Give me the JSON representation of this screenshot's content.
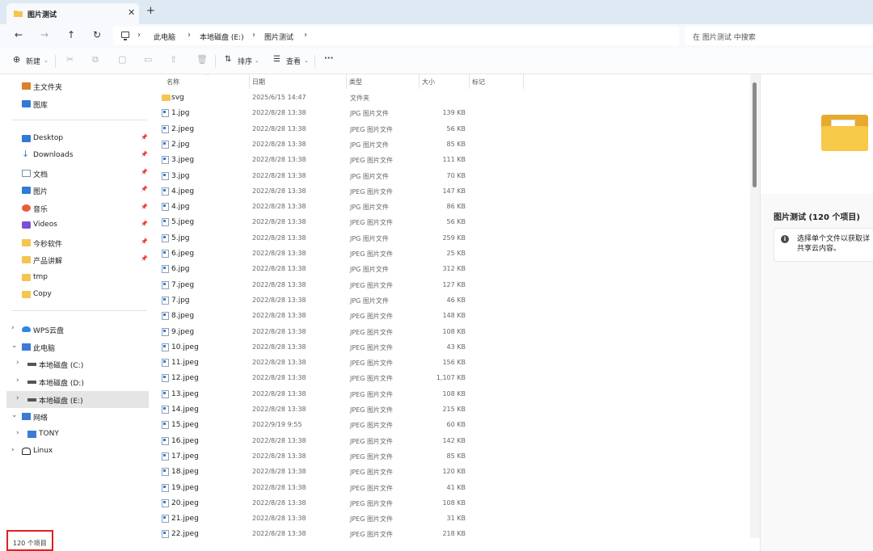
{
  "tab": {
    "title": "图片测试",
    "close": "✕",
    "new": "+"
  },
  "nav_buttons": {
    "back": "←",
    "forward": "→",
    "up": "↑",
    "refresh": "↻"
  },
  "breadcrumb": [
    "此电脑",
    "本地磁盘 (E:)",
    "图片测试"
  ],
  "search": {
    "placeholder": "在 图片测试 中搜索"
  },
  "toolbar": {
    "new_label": "新建",
    "sort_label": "排序",
    "view_label": "查看",
    "more_label": "···"
  },
  "sidebar": {
    "top": [
      {
        "label": "主文件夹",
        "icon": "home-icon"
      },
      {
        "label": "图库",
        "icon": "gallery-icon"
      }
    ],
    "quick": [
      {
        "label": "Desktop",
        "icon": "desktop-icon"
      },
      {
        "label": "Downloads",
        "icon": "download-icon"
      },
      {
        "label": "文档",
        "icon": "document-icon"
      },
      {
        "label": "图片",
        "icon": "pictures-icon"
      },
      {
        "label": "音乐",
        "icon": "music-icon"
      },
      {
        "label": "Videos",
        "icon": "videos-icon"
      },
      {
        "label": "今秒软件",
        "icon": "folder-icon"
      },
      {
        "label": "产品讲解",
        "icon": "folder-icon"
      },
      {
        "label": "tmp",
        "icon": "folder-icon"
      },
      {
        "label": "Copy",
        "icon": "folder-icon"
      }
    ],
    "tree": [
      {
        "label": "WPS云盘",
        "icon": "cloud-icon"
      },
      {
        "label": "此电脑",
        "icon": "computer-icon"
      },
      {
        "label": "本地磁盘 (C:)",
        "icon": "drive-icon"
      },
      {
        "label": "本地磁盘 (D:)",
        "icon": "drive-icon"
      },
      {
        "label": "本地磁盘 (E:)",
        "icon": "drive-icon"
      },
      {
        "label": "网络",
        "icon": "network-icon"
      },
      {
        "label": "TONY",
        "icon": "computer-icon"
      },
      {
        "label": "Linux",
        "icon": "linux-icon"
      }
    ]
  },
  "columns": {
    "name": "名称",
    "date": "日期",
    "type": "类型",
    "size": "大小",
    "tag": "标记"
  },
  "files": [
    {
      "name": "svg",
      "date": "2025/6/15 14:47",
      "type": "文件夹",
      "size": ""
    },
    {
      "name": "1.jpg",
      "date": "2022/8/28 13:38",
      "type": "JPG 图片文件",
      "size": "139 KB"
    },
    {
      "name": "2.jpeg",
      "date": "2022/8/28 13:38",
      "type": "JPEG 图片文件",
      "size": "56 KB"
    },
    {
      "name": "2.jpg",
      "date": "2022/8/28 13:38",
      "type": "JPG 图片文件",
      "size": "85 KB"
    },
    {
      "name": "3.jpeg",
      "date": "2022/8/28 13:38",
      "type": "JPEG 图片文件",
      "size": "111 KB"
    },
    {
      "name": "3.jpg",
      "date": "2022/8/28 13:38",
      "type": "JPG 图片文件",
      "size": "70 KB"
    },
    {
      "name": "4.jpeg",
      "date": "2022/8/28 13:38",
      "type": "JPEG 图片文件",
      "size": "147 KB"
    },
    {
      "name": "4.jpg",
      "date": "2022/8/28 13:38",
      "type": "JPG 图片文件",
      "size": "86 KB"
    },
    {
      "name": "5.jpeg",
      "date": "2022/8/28 13:38",
      "type": "JPEG 图片文件",
      "size": "56 KB"
    },
    {
      "name": "5.jpg",
      "date": "2022/8/28 13:38",
      "type": "JPG 图片文件",
      "size": "259 KB"
    },
    {
      "name": "6.jpeg",
      "date": "2022/8/28 13:38",
      "type": "JPEG 图片文件",
      "size": "25 KB"
    },
    {
      "name": "6.jpg",
      "date": "2022/8/28 13:38",
      "type": "JPG 图片文件",
      "size": "312 KB"
    },
    {
      "name": "7.jpeg",
      "date": "2022/8/28 13:38",
      "type": "JPEG 图片文件",
      "size": "127 KB"
    },
    {
      "name": "7.jpg",
      "date": "2022/8/28 13:38",
      "type": "JPG 图片文件",
      "size": "46 KB"
    },
    {
      "name": "8.jpeg",
      "date": "2022/8/28 13:38",
      "type": "JPEG 图片文件",
      "size": "148 KB"
    },
    {
      "name": "9.jpeg",
      "date": "2022/8/28 13:38",
      "type": "JPEG 图片文件",
      "size": "108 KB"
    },
    {
      "name": "10.jpeg",
      "date": "2022/8/28 13:38",
      "type": "JPEG 图片文件",
      "size": "43 KB"
    },
    {
      "name": "11.jpeg",
      "date": "2022/8/28 13:38",
      "type": "JPEG 图片文件",
      "size": "156 KB"
    },
    {
      "name": "12.jpeg",
      "date": "2022/8/28 13:38",
      "type": "JPEG 图片文件",
      "size": "1,107 KB"
    },
    {
      "name": "13.jpeg",
      "date": "2022/8/28 13:38",
      "type": "JPEG 图片文件",
      "size": "108 KB"
    },
    {
      "name": "14.jpeg",
      "date": "2022/8/28 13:38",
      "type": "JPEG 图片文件",
      "size": "215 KB"
    },
    {
      "name": "15.jpeg",
      "date": "2022/9/19 9:55",
      "type": "JPEG 图片文件",
      "size": "60 KB"
    },
    {
      "name": "16.jpeg",
      "date": "2022/8/28 13:38",
      "type": "JPEG 图片文件",
      "size": "142 KB"
    },
    {
      "name": "17.jpeg",
      "date": "2022/8/28 13:38",
      "type": "JPEG 图片文件",
      "size": "85 KB"
    },
    {
      "name": "18.jpeg",
      "date": "2022/8/28 13:38",
      "type": "JPEG 图片文件",
      "size": "120 KB"
    },
    {
      "name": "19.jpeg",
      "date": "2022/8/28 13:38",
      "type": "JPEG 图片文件",
      "size": "41 KB"
    },
    {
      "name": "20.jpeg",
      "date": "2022/8/28 13:38",
      "type": "JPEG 图片文件",
      "size": "108 KB"
    },
    {
      "name": "21.jpeg",
      "date": "2022/8/28 13:38",
      "type": "JPEG 图片文件",
      "size": "31 KB"
    },
    {
      "name": "22.jpeg",
      "date": "2022/8/28 13:38",
      "type": "JPEG 图片文件",
      "size": "218 KB"
    }
  ],
  "preview": {
    "title": "图片测试 (120 个项目)",
    "info_line1": "选择单个文件以获取详",
    "info_line2": "共享云内容。"
  },
  "status": {
    "count": "120 个项目"
  }
}
